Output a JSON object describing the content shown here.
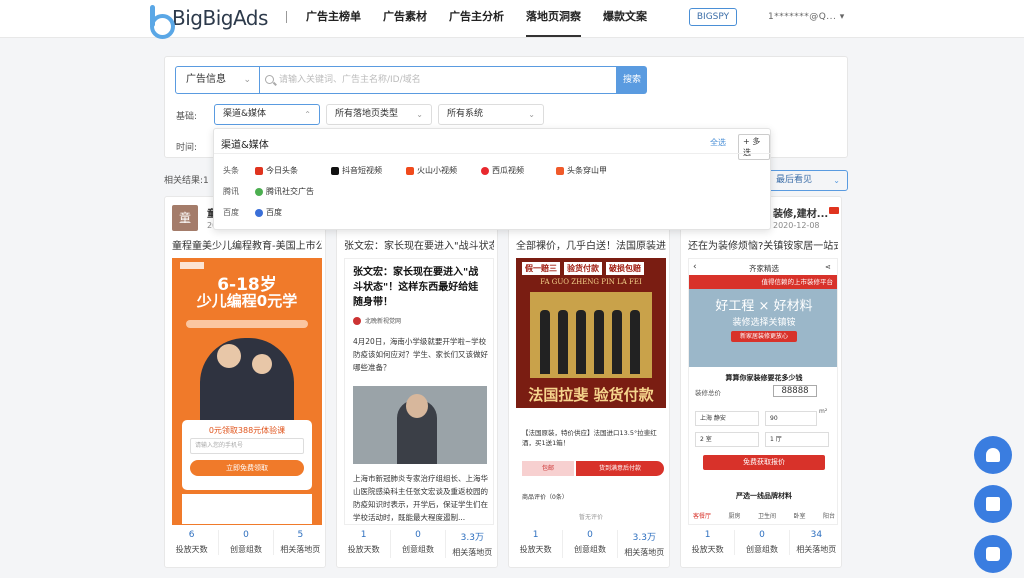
{
  "brand": {
    "name": "BigBigAds"
  },
  "nav": [
    {
      "label": "广告主榜单",
      "active": false
    },
    {
      "label": "广告素材",
      "active": false
    },
    {
      "label": "广告主分析",
      "active": false
    },
    {
      "label": "落地页洞察",
      "active": true
    },
    {
      "label": "爆款文案",
      "active": false
    }
  ],
  "header": {
    "bigspy_label": "BIGSPY",
    "user_label": "1*******@Q..."
  },
  "search": {
    "type_value": "广告信息",
    "placeholder": "请输入关键词、广告主名称/ID/域名",
    "button": "搜索"
  },
  "filters": {
    "basic_label": "基础:",
    "time_label": "时间:",
    "channel_value": "渠道&媒体",
    "landing_type_value": "所有落地页类型",
    "system_value": "所有系统"
  },
  "popup": {
    "title": "渠道&媒体",
    "select_all": "全选",
    "multi": "+ 多选",
    "groups": [
      {
        "label": "头条",
        "items": [
          "今日头条",
          "抖音短视频",
          "火山小视频",
          "西瓜视频",
          "头条穿山甲"
        ]
      },
      {
        "label": "腾讯",
        "items": [
          "腾讯社交广告"
        ]
      },
      {
        "label": "百度",
        "items": [
          "百度"
        ]
      }
    ]
  },
  "results": {
    "label": "相关结果:1",
    "sort_value": "最后看见"
  },
  "cards": [
    {
      "avatar": "童",
      "advertiser": "童",
      "date": "20",
      "title": "童程童美少儿编程教育-美国上市公...",
      "creative": {
        "headline": "6-18岁",
        "sub": "少儿编程0元学",
        "cta": "0元领取388元体验课",
        "input": "请输入您的手机号",
        "btn": "立即免费领取"
      },
      "stats": [
        {
          "v": "6",
          "l": "投放天数"
        },
        {
          "v": "0",
          "l": "创意组数"
        },
        {
          "v": "5",
          "l": "相关落地页"
        }
      ]
    },
    {
      "title": "张文宏：家长现在要进入\"战斗状态...",
      "creative": {
        "headline": "张文宏：家长现在要进入\"战斗状态\"！这样东西最好给娃随身带！",
        "source": "北晚新视觉网",
        "body": "4月20日，海南小学级就要开学啦~学校防疫该如何应对？学生、家长们又该做好哪些准备？",
        "body2": "上海市新冠肺炎专家治疗组组长、上海华山医院感染科主任张文宏谈及重返校园的防疫知识时表示，开学后，保证学生们在学校活动时，既能最大程度遏制..."
      },
      "stats": [
        {
          "v": "1",
          "l": "投放天数"
        },
        {
          "v": "0",
          "l": "创意组数"
        },
        {
          "v": "3.3万",
          "l": "相关落地页"
        }
      ]
    },
    {
      "title": "全部裸价，几乎白送！法国原装进...",
      "creative": {
        "tags": [
          "假一赔三",
          "验货付款",
          "破损包赔"
        ],
        "brand_line": "FA GUO ZHENG PIN LA FEI",
        "banner": "法国拉斐  验货付款",
        "desc": "【法国原装，特价供应】法国进口13.5°拉斐红酒，买1送1箱！",
        "btn1": "包邮",
        "btn2": "货到满意后付款",
        "meta": "商品评价（0条）",
        "meta2": "暂无评价"
      },
      "stats": [
        {
          "v": "1",
          "l": "投放天数"
        },
        {
          "v": "0",
          "l": "创意组数"
        },
        {
          "v": "3.3万",
          "l": "相关落地页"
        }
      ]
    },
    {
      "advertiser": "装修,建材...",
      "date": "2020-12-08",
      "title": "还在为装修烦恼?关镇铵家居一站式...",
      "creative": {
        "appbar": "齐家精选",
        "promo": "值得信赖的上市装修平台",
        "hero1": "好工程 × 好材料",
        "hero2": "装修选择关镇铵",
        "hero3": "新家居装修更放心",
        "calc_title": "算算你家装修要花多少钱",
        "calc_label": "装修总价",
        "calc_value": "88888",
        "city": "上海 静安",
        "area": "90",
        "unit": "m²",
        "room1": "2 室",
        "room2": "1 厅",
        "btn": "免费获取报价",
        "foot": "严选一线品牌材料",
        "tabs": [
          "客餐厅",
          "厨房",
          "卫生间",
          "卧室",
          "阳台"
        ]
      },
      "stats": [
        {
          "v": "1",
          "l": "投放天数"
        },
        {
          "v": "0",
          "l": "创意组数"
        },
        {
          "v": "34",
          "l": "相关落地页"
        }
      ]
    }
  ],
  "colors": {
    "accent": "#5a9be0",
    "fab": "#3a7de0"
  }
}
